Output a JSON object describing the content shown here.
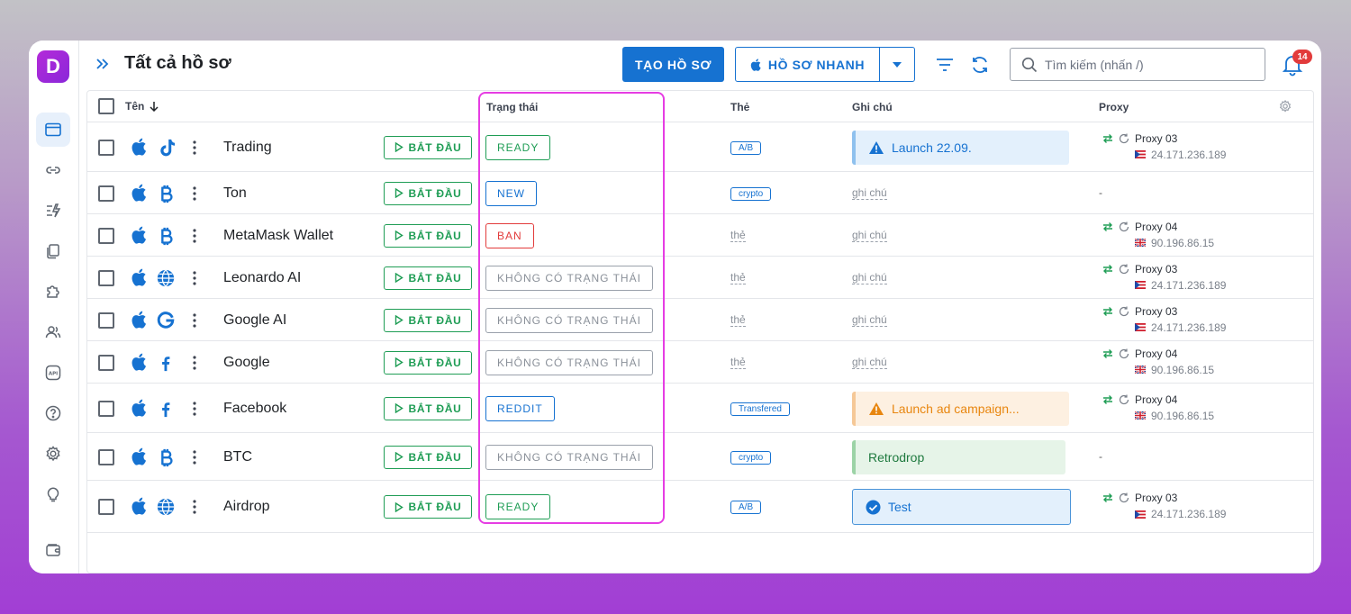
{
  "header": {
    "title": "Tất cả hồ sơ",
    "create_button": "TẠO HỒ SƠ",
    "quick_button": "HỒ SƠ NHANH",
    "search_placeholder": "Tìm kiếm (nhấn /)",
    "notification_count": "14"
  },
  "sidebar": {
    "logo": "D",
    "items": [
      {
        "icon": "browser-window-icon",
        "active": true
      },
      {
        "icon": "link-icon"
      },
      {
        "icon": "automation-icon"
      },
      {
        "icon": "copy-icon"
      },
      {
        "icon": "extension-icon"
      },
      {
        "icon": "users-icon"
      },
      {
        "icon": "api-icon"
      },
      {
        "icon": "help-icon"
      },
      {
        "icon": "settings-icon"
      },
      {
        "icon": "lightbulb-icon"
      },
      {
        "icon": "wallet-icon"
      }
    ]
  },
  "table": {
    "columns": {
      "name": "Tên",
      "status": "Trạng thái",
      "tag": "Thẻ",
      "note": "Ghi chú",
      "proxy": "Proxy"
    },
    "start_label": "BẮT ĐẦU",
    "empty_tag": "thẻ",
    "empty_note": "ghi chú",
    "rows": [
      {
        "name": "Trading",
        "site": "tiktok-icon",
        "status": "READY",
        "status_color": "green",
        "tag": "A/B",
        "note": "Launch 22.09.",
        "note_type": "info",
        "proxy_name": "Proxy 03",
        "proxy_ip": "24.171.236.189",
        "flag": "pr"
      },
      {
        "name": "Ton",
        "site": "bitcoin-icon",
        "status": "NEW",
        "status_color": "blue",
        "tag": "crypto",
        "note": "",
        "note_type": "empty",
        "proxy_name": "",
        "proxy_ip": "",
        "flag": "",
        "proxy_empty": "-"
      },
      {
        "name": "MetaMask Wallet",
        "site": "bitcoin-icon",
        "status": "BAN",
        "status_color": "red",
        "tag": "",
        "note": "",
        "note_type": "empty",
        "proxy_name": "Proxy 04",
        "proxy_ip": "90.196.86.15",
        "flag": "uk"
      },
      {
        "name": "Leonardo AI",
        "site": "globe-icon",
        "status": "KHÔNG CÓ TRẠNG THÁI",
        "status_color": "gray",
        "tag": "",
        "note": "",
        "note_type": "empty",
        "proxy_name": "Proxy 03",
        "proxy_ip": "24.171.236.189",
        "flag": "pr"
      },
      {
        "name": "Google AI",
        "site": "google-icon",
        "status": "KHÔNG CÓ TRẠNG THÁI",
        "status_color": "gray",
        "tag": "",
        "note": "",
        "note_type": "empty",
        "proxy_name": "Proxy 03",
        "proxy_ip": "24.171.236.189",
        "flag": "pr"
      },
      {
        "name": "Google",
        "site": "facebook-icon",
        "status": "KHÔNG CÓ TRẠNG THÁI",
        "status_color": "gray",
        "tag": "",
        "note": "",
        "note_type": "empty",
        "proxy_name": "Proxy 04",
        "proxy_ip": "90.196.86.15",
        "flag": "uk"
      },
      {
        "name": "Facebook",
        "site": "facebook-icon",
        "status": "REDDIT",
        "status_color": "blue",
        "tag": "Transfered",
        "note": "Launch ad campaign...",
        "note_type": "warn",
        "proxy_name": "Proxy 04",
        "proxy_ip": "90.196.86.15",
        "flag": "uk"
      },
      {
        "name": "BTC",
        "site": "bitcoin-icon",
        "status": "KHÔNG CÓ TRẠNG THÁI",
        "status_color": "gray",
        "tag": "crypto",
        "note": "Retrodrop",
        "note_type": "ok",
        "proxy_name": "",
        "proxy_ip": "",
        "flag": "",
        "proxy_empty": "-"
      },
      {
        "name": "Airdrop",
        "site": "globe-icon",
        "status": "READY",
        "status_color": "green",
        "tag": "A/B",
        "note": "Test",
        "note_type": "done",
        "proxy_name": "Proxy 03",
        "proxy_ip": "24.171.236.189",
        "flag": "pr"
      }
    ]
  },
  "colors": {
    "primary": "#1672d1",
    "success": "#1f9d55",
    "danger": "#e23b3b",
    "highlight": "#e63de3"
  }
}
